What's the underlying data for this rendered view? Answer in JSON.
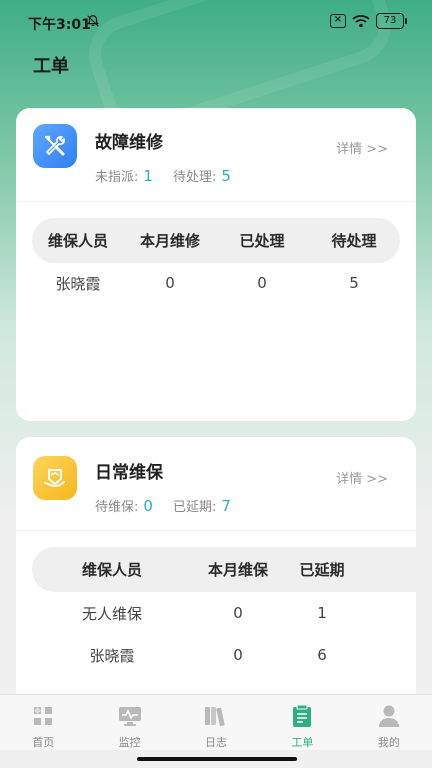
{
  "status_bar": {
    "time": "下午3:01",
    "battery": "73"
  },
  "page": {
    "title": "工单"
  },
  "repair_card": {
    "title": "故障维修",
    "detail_label": "详情 >>",
    "stats": [
      {
        "label": "未指派:",
        "value": "1"
      },
      {
        "label": "待处理:",
        "value": "5"
      }
    ],
    "columns": [
      "维保人员",
      "本月维修",
      "已处理",
      "待处理"
    ],
    "rows": [
      [
        "张晓霞",
        "0",
        "0",
        "5"
      ]
    ]
  },
  "maintenance_card": {
    "title": "日常维保",
    "detail_label": "详情 >>",
    "stats": [
      {
        "label": "待维保:",
        "value": "0"
      },
      {
        "label": "已延期:",
        "value": "7"
      }
    ],
    "columns": [
      "维保人员",
      "本月维保",
      "已延期"
    ],
    "rows": [
      [
        "无人维保",
        "0",
        "1"
      ],
      [
        "张晓霞",
        "0",
        "6"
      ]
    ]
  },
  "tabbar": {
    "items": [
      {
        "label": "首页",
        "icon": "home-icon"
      },
      {
        "label": "监控",
        "icon": "monitor-icon"
      },
      {
        "label": "日志",
        "icon": "log-icon"
      },
      {
        "label": "工单",
        "icon": "work-order-icon"
      },
      {
        "label": "我的",
        "icon": "profile-icon"
      }
    ],
    "active_index": 3
  },
  "colors": {
    "accent": "#2fae84",
    "stat_value": "#25b1c2",
    "repair_icon": "#3d8ef8",
    "maintenance_icon": "#f7c12f"
  }
}
